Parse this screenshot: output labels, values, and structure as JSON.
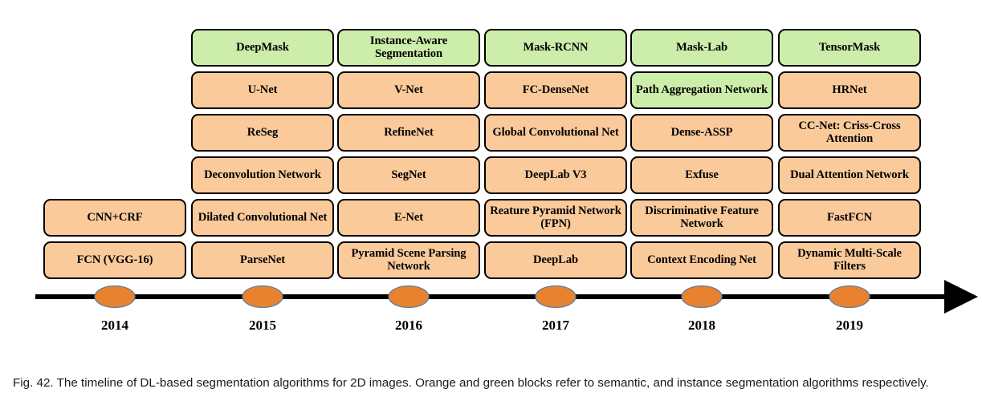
{
  "figure": {
    "caption": "Fig. 42. The timeline of DL-based segmentation algorithms for 2D images. Orange and green blocks refer to semantic, and instance segmentation algorithms respectively."
  },
  "legend": {
    "semantic_color": "#FBCA9B",
    "instance_color": "#CDEEAA",
    "marker_color": "#E8822F",
    "marker_border_color": "#5B7FA6",
    "axis_color": "#000000",
    "box_border_color": "#000000"
  },
  "chart_data": {
    "type": "table",
    "title": "The timeline of DL-based segmentation algorithms for 2D images",
    "xlabel": "",
    "ylabel": "",
    "categories": [
      "2014",
      "2015",
      "2016",
      "2017",
      "2018",
      "2019"
    ],
    "legend": [
      {
        "label": "semantic segmentation",
        "color": "#FBCA9B"
      },
      {
        "label": "instance segmentation",
        "color": "#CDEEAA"
      }
    ],
    "columns": [
      {
        "year": "2014",
        "items": [
          {
            "label": "CNN+CRF",
            "type": "semantic"
          },
          {
            "label": "FCN (VGG-16)",
            "type": "semantic"
          }
        ]
      },
      {
        "year": "2015",
        "items": [
          {
            "label": "DeepMask",
            "type": "instance"
          },
          {
            "label": "U-Net",
            "type": "semantic"
          },
          {
            "label": "ReSeg",
            "type": "semantic"
          },
          {
            "label": "Deconvolution Network",
            "type": "semantic"
          },
          {
            "label": "Dilated Convolutional Net",
            "type": "semantic"
          },
          {
            "label": "ParseNet",
            "type": "semantic"
          }
        ]
      },
      {
        "year": "2016",
        "items": [
          {
            "label": "Instance-Aware Segmentation",
            "type": "instance"
          },
          {
            "label": "V-Net",
            "type": "semantic"
          },
          {
            "label": "RefineNet",
            "type": "semantic"
          },
          {
            "label": "SegNet",
            "type": "semantic"
          },
          {
            "label": "E-Net",
            "type": "semantic"
          },
          {
            "label": "Pyramid Scene Parsing Network",
            "type": "semantic"
          }
        ]
      },
      {
        "year": "2017",
        "items": [
          {
            "label": "Mask-RCNN",
            "type": "instance"
          },
          {
            "label": "FC-DenseNet",
            "type": "semantic"
          },
          {
            "label": "Global Convolutional Net",
            "type": "semantic"
          },
          {
            "label": "DeepLab V3",
            "type": "semantic"
          },
          {
            "label": "Reature Pyramid Network (FPN)",
            "type": "semantic"
          },
          {
            "label": "DeepLab",
            "type": "semantic"
          }
        ]
      },
      {
        "year": "2018",
        "items": [
          {
            "label": "Mask-Lab",
            "type": "instance"
          },
          {
            "label": "Path Aggregation Network",
            "type": "instance"
          },
          {
            "label": "Dense-ASSP",
            "type": "semantic"
          },
          {
            "label": "Exfuse",
            "type": "semantic"
          },
          {
            "label": "Discriminative Feature Network",
            "type": "semantic"
          },
          {
            "label": "Context Encoding Net",
            "type": "semantic"
          }
        ]
      },
      {
        "year": "2019",
        "items": [
          {
            "label": "TensorMask",
            "type": "instance"
          },
          {
            "label": "HRNet",
            "type": "semantic"
          },
          {
            "label": "CC-Net: Criss-Cross Attention",
            "type": "semantic"
          },
          {
            "label": "Dual Attention Network",
            "type": "semantic"
          },
          {
            "label": "FastFCN",
            "type": "semantic"
          },
          {
            "label": "Dynamic Multi-Scale Filters",
            "type": "semantic"
          }
        ]
      }
    ]
  }
}
